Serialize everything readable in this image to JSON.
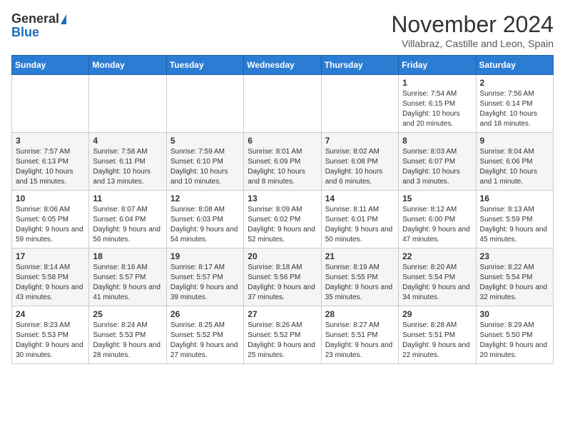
{
  "header": {
    "logo_general": "General",
    "logo_blue": "Blue",
    "month": "November 2024",
    "location": "Villabraz, Castille and Leon, Spain"
  },
  "days_of_week": [
    "Sunday",
    "Monday",
    "Tuesday",
    "Wednesday",
    "Thursday",
    "Friday",
    "Saturday"
  ],
  "weeks": [
    [
      {
        "day": null
      },
      {
        "day": null
      },
      {
        "day": null
      },
      {
        "day": null
      },
      {
        "day": null
      },
      {
        "day": "1",
        "sunrise": "7:54 AM",
        "sunset": "6:15 PM",
        "daylight": "10 hours and 20 minutes."
      },
      {
        "day": "2",
        "sunrise": "7:56 AM",
        "sunset": "6:14 PM",
        "daylight": "10 hours and 18 minutes."
      }
    ],
    [
      {
        "day": "3",
        "sunrise": "7:57 AM",
        "sunset": "6:13 PM",
        "daylight": "10 hours and 15 minutes."
      },
      {
        "day": "4",
        "sunrise": "7:58 AM",
        "sunset": "6:11 PM",
        "daylight": "10 hours and 13 minutes."
      },
      {
        "day": "5",
        "sunrise": "7:59 AM",
        "sunset": "6:10 PM",
        "daylight": "10 hours and 10 minutes."
      },
      {
        "day": "6",
        "sunrise": "8:01 AM",
        "sunset": "6:09 PM",
        "daylight": "10 hours and 8 minutes."
      },
      {
        "day": "7",
        "sunrise": "8:02 AM",
        "sunset": "6:08 PM",
        "daylight": "10 hours and 6 minutes."
      },
      {
        "day": "8",
        "sunrise": "8:03 AM",
        "sunset": "6:07 PM",
        "daylight": "10 hours and 3 minutes."
      },
      {
        "day": "9",
        "sunrise": "8:04 AM",
        "sunset": "6:06 PM",
        "daylight": "10 hours and 1 minute."
      }
    ],
    [
      {
        "day": "10",
        "sunrise": "8:06 AM",
        "sunset": "6:05 PM",
        "daylight": "9 hours and 59 minutes."
      },
      {
        "day": "11",
        "sunrise": "8:07 AM",
        "sunset": "6:04 PM",
        "daylight": "9 hours and 56 minutes."
      },
      {
        "day": "12",
        "sunrise": "8:08 AM",
        "sunset": "6:03 PM",
        "daylight": "9 hours and 54 minutes."
      },
      {
        "day": "13",
        "sunrise": "8:09 AM",
        "sunset": "6:02 PM",
        "daylight": "9 hours and 52 minutes."
      },
      {
        "day": "14",
        "sunrise": "8:11 AM",
        "sunset": "6:01 PM",
        "daylight": "9 hours and 50 minutes."
      },
      {
        "day": "15",
        "sunrise": "8:12 AM",
        "sunset": "6:00 PM",
        "daylight": "9 hours and 47 minutes."
      },
      {
        "day": "16",
        "sunrise": "8:13 AM",
        "sunset": "5:59 PM",
        "daylight": "9 hours and 45 minutes."
      }
    ],
    [
      {
        "day": "17",
        "sunrise": "8:14 AM",
        "sunset": "5:58 PM",
        "daylight": "9 hours and 43 minutes."
      },
      {
        "day": "18",
        "sunrise": "8:16 AM",
        "sunset": "5:57 PM",
        "daylight": "9 hours and 41 minutes."
      },
      {
        "day": "19",
        "sunrise": "8:17 AM",
        "sunset": "5:57 PM",
        "daylight": "9 hours and 39 minutes."
      },
      {
        "day": "20",
        "sunrise": "8:18 AM",
        "sunset": "5:56 PM",
        "daylight": "9 hours and 37 minutes."
      },
      {
        "day": "21",
        "sunrise": "8:19 AM",
        "sunset": "5:55 PM",
        "daylight": "9 hours and 35 minutes."
      },
      {
        "day": "22",
        "sunrise": "8:20 AM",
        "sunset": "5:54 PM",
        "daylight": "9 hours and 34 minutes."
      },
      {
        "day": "23",
        "sunrise": "8:22 AM",
        "sunset": "5:54 PM",
        "daylight": "9 hours and 32 minutes."
      }
    ],
    [
      {
        "day": "24",
        "sunrise": "8:23 AM",
        "sunset": "5:53 PM",
        "daylight": "9 hours and 30 minutes."
      },
      {
        "day": "25",
        "sunrise": "8:24 AM",
        "sunset": "5:53 PM",
        "daylight": "9 hours and 28 minutes."
      },
      {
        "day": "26",
        "sunrise": "8:25 AM",
        "sunset": "5:52 PM",
        "daylight": "9 hours and 27 minutes."
      },
      {
        "day": "27",
        "sunrise": "8:26 AM",
        "sunset": "5:52 PM",
        "daylight": "9 hours and 25 minutes."
      },
      {
        "day": "28",
        "sunrise": "8:27 AM",
        "sunset": "5:51 PM",
        "daylight": "9 hours and 23 minutes."
      },
      {
        "day": "29",
        "sunrise": "8:28 AM",
        "sunset": "5:51 PM",
        "daylight": "9 hours and 22 minutes."
      },
      {
        "day": "30",
        "sunrise": "8:29 AM",
        "sunset": "5:50 PM",
        "daylight": "9 hours and 20 minutes."
      }
    ]
  ]
}
